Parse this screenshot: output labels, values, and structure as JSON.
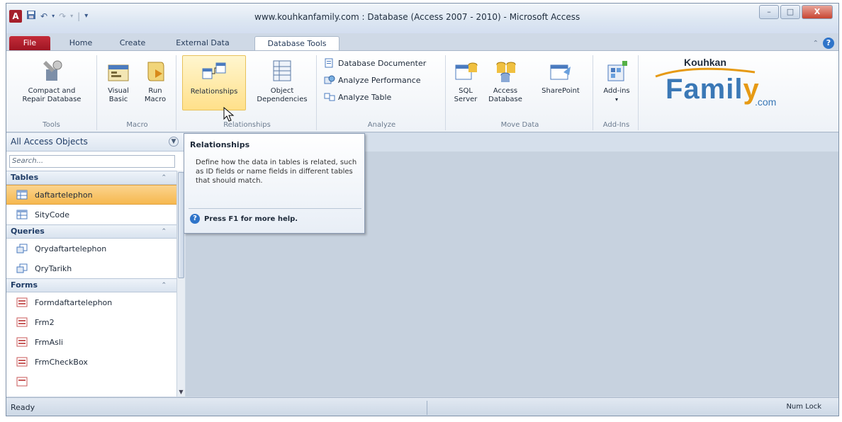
{
  "window": {
    "title": "www.kouhkanfamily.com : Database (Access 2007 - 2010)  -  Microsoft Access",
    "app_icon": "A",
    "controls": {
      "minimize": "–",
      "maximize": "□",
      "close": "X"
    }
  },
  "tabs": [
    {
      "label": "File"
    },
    {
      "label": "Home"
    },
    {
      "label": "Create"
    },
    {
      "label": "External Data"
    },
    {
      "label": "Database Tools"
    }
  ],
  "ribbon": {
    "groups": {
      "tools": {
        "label": "Tools",
        "buttons": [
          "Compact and",
          "Repair Database"
        ]
      },
      "macro": {
        "label": "Macro",
        "visual_basic": [
          "Visual",
          "Basic"
        ],
        "run_macro": [
          "Run",
          "Macro"
        ]
      },
      "relationships": {
        "label": "Relationships",
        "relationships": "Relationships",
        "object_dependencies": [
          "Object",
          "Dependencies"
        ]
      },
      "analyze": {
        "label": "Analyze",
        "documenter": "Database Documenter",
        "performance": "Analyze Performance",
        "table": "Analyze Table"
      },
      "move_data": {
        "label": "Move Data",
        "sql_server": [
          "SQL",
          "Server"
        ],
        "access_database": [
          "Access",
          "Database"
        ],
        "sharepoint": "SharePoint"
      },
      "add_ins": {
        "label": "Add-Ins",
        "add_ins": "Add-ins"
      }
    },
    "logo": {
      "top": "Kouhkan",
      "main_a": "Famil",
      "main_y": "y",
      "com": ".com"
    }
  },
  "nav": {
    "header": "All Access Objects",
    "search_placeholder": "Search...",
    "sections": [
      {
        "title": "Tables",
        "items": [
          "daftartelephon",
          "SityCode"
        ]
      },
      {
        "title": "Queries",
        "items": [
          "Qrydaftartelephon",
          "QryTarikh"
        ]
      },
      {
        "title": "Forms",
        "items": [
          "Formdaftartelephon",
          "Frm2",
          "FrmAsli",
          "FrmCheckBox"
        ]
      }
    ]
  },
  "tooltip": {
    "title": "Relationships",
    "body": "Define how the data in tables is related, such as ID fields or name fields in different tables that should match.",
    "help": "Press F1 for more help."
  },
  "status": {
    "left": "Ready",
    "right": "Num Lock"
  },
  "colors": {
    "file_tab": "#b01e2d",
    "selected_item": "#f6b84f",
    "hot_button": "#ffe08a",
    "logo_blue": "#3a78b6",
    "logo_orange": "#e69a14"
  }
}
